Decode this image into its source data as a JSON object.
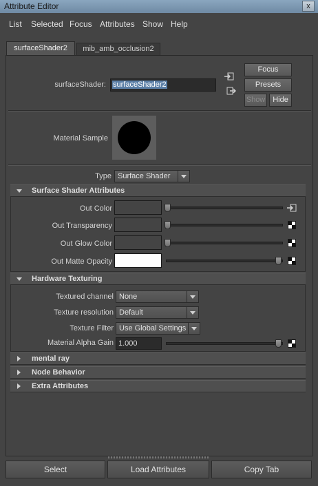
{
  "window": {
    "title": "Attribute Editor",
    "close_glyph": "x"
  },
  "menu": [
    "List",
    "Selected",
    "Focus",
    "Attributes",
    "Show",
    "Help"
  ],
  "tabs": [
    {
      "label": "surfaceShader2",
      "active": true
    },
    {
      "label": "mib_amb_occlusion2",
      "active": false
    }
  ],
  "node": {
    "label": "surfaceShader:",
    "value": "surfaceShader2"
  },
  "side_buttons": {
    "focus": "Focus",
    "presets": "Presets",
    "show": "Show",
    "hide": "Hide"
  },
  "material_sample": {
    "label": "Material Sample"
  },
  "type": {
    "label": "Type",
    "value": "Surface Shader"
  },
  "sections": {
    "surface": {
      "title": "Surface Shader Attributes",
      "expanded": true
    },
    "hardware": {
      "title": "Hardware Texturing",
      "expanded": true
    },
    "mental_ray": {
      "title": "mental ray",
      "expanded": false
    },
    "node_behavior": {
      "title": "Node Behavior",
      "expanded": false
    },
    "extra": {
      "title": "Extra Attributes",
      "expanded": false
    }
  },
  "surface_attrs": [
    {
      "label": "Out Color",
      "color": "#000000",
      "slider": 0.0
    },
    {
      "label": "Out Transparency",
      "color": "#000000",
      "slider": 0.0
    },
    {
      "label": "Out Glow Color",
      "color": "#000000",
      "slider": 0.0
    },
    {
      "label": "Out Matte Opacity",
      "color": "#ffffff",
      "slider": 1.0
    }
  ],
  "hardware": {
    "textured_channel": {
      "label": "Textured channel",
      "value": "None"
    },
    "texture_resolution": {
      "label": "Texture resolution",
      "value": "Default"
    },
    "texture_filter": {
      "label": "Texture Filter",
      "value": "Use Global Settings"
    },
    "alpha_gain": {
      "label": "Material Alpha Gain",
      "value": "1.000",
      "slider": 1.0
    }
  },
  "bottom_buttons": {
    "select": "Select",
    "load": "Load Attributes",
    "copy": "Copy Tab"
  },
  "colors": {
    "selection_highlight": "#5b7fa6",
    "panel": "#444444"
  }
}
